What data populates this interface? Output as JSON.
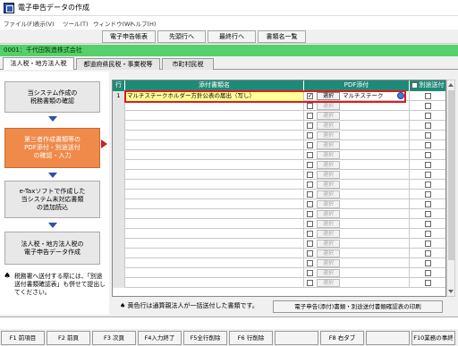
{
  "window": {
    "title": "電子申告データの作成"
  },
  "menu": [
    "ファイル(F)",
    "表示(V)",
    "ツール(T)",
    "ウィンドウ(W)",
    "ヘルプ(H)"
  ],
  "toolbar": [
    "電子申告帳表",
    "先頭行へ",
    "最終行へ",
    "書類名一覧"
  ],
  "company": "0001：千代田製造株式会社",
  "tabs": [
    "法人税・地方法人税",
    "都道府県民税・事業税等",
    "市町村民税"
  ],
  "steps": [
    "当システム作成の\n税務書類の確認",
    "第三者作成書類等の\nPDF添付・別途送付\nの確認・入力",
    "e-Taxソフトで作成した\n当システム未対応書類\nの追加読込",
    "法人税・地方法人税の\n電子申告データ作成"
  ],
  "note": "税務署へ送付する際には、「別途送付書類確認表」も併せて提出してください。",
  "grid": {
    "headers": {
      "row": "行",
      "doc": "添付書類名",
      "pdf": "PDF添付",
      "send": "別途送付"
    },
    "select_label": "選択",
    "rows": [
      {
        "num": "1",
        "doc": "マルチステークホルダー方針公表の届出（写し）",
        "checked": true,
        "file": "マルチステーク",
        "active": true
      }
    ],
    "row_count": 20
  },
  "legend": "黄色行は通算親法人が一括送付した書類です。",
  "print_button": "電子申告(添付)書類・別途送付書類確認表の印刷",
  "fkeys": [
    "F1 前項目",
    "F2 前頁",
    "F3 次頁",
    "F4入力終了",
    "F5全行削除",
    "F6 行削除",
    "",
    "F8 右タブ",
    "",
    "F10業務の事終了"
  ],
  "colors": {
    "header": "#1f8a78",
    "company": "#55d06a",
    "active_step": "#ef8a4a",
    "highlight": "#e21a1a",
    "doc_row": "#ffff99"
  }
}
